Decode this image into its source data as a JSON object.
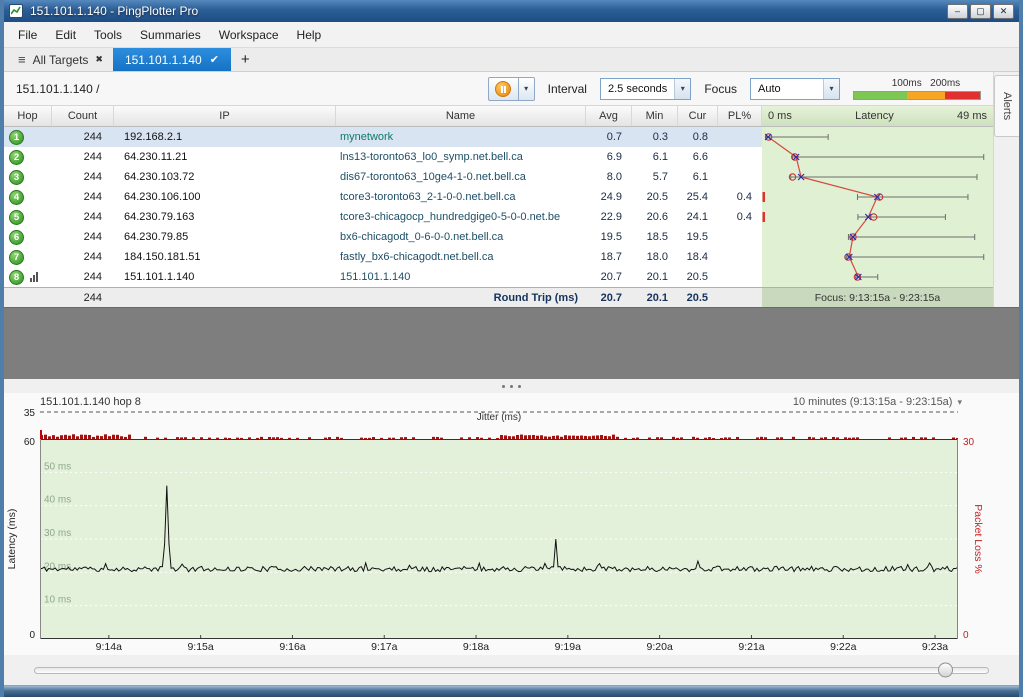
{
  "window": {
    "title": "151.101.1.140 - PingPlotter Pro",
    "minimize_glyph": "–",
    "maximize_glyph": "▢",
    "close_glyph": "✕"
  },
  "glyphs": {
    "caret": "▾",
    "hamburger": "≡"
  },
  "menu": {
    "items": [
      "File",
      "Edit",
      "Tools",
      "Summaries",
      "Workspace",
      "Help"
    ]
  },
  "tabs": {
    "all_targets_label": "All Targets",
    "all_targets_close": "✖",
    "active_label": "151.101.1.140",
    "active_check": "✔",
    "new_tab": "+"
  },
  "toolbar": {
    "target_label": "151.101.1.140 /",
    "interval_label": "Interval",
    "interval_value": "2.5 seconds",
    "focus_label": "Focus",
    "focus_value": "Auto",
    "legend": {
      "label_100": "100ms",
      "label_200": "200ms",
      "color_ok": "#7dc855",
      "color_warn": "#f5a623",
      "color_bad": "#e03030"
    }
  },
  "alerts_tab_label": "Alerts",
  "table": {
    "name_color": "#1d4f66",
    "headers": {
      "hop": "Hop",
      "count": "Count",
      "ip": "IP",
      "name": "Name",
      "avg": "Avg",
      "min": "Min",
      "cur": "Cur",
      "pl": "PL%",
      "graph_left": "0 ms",
      "graph_title": "Latency",
      "graph_right": "49 ms"
    },
    "rows": [
      {
        "hop": 1,
        "count": "244",
        "ip": "192.168.2.1",
        "name": "mynetwork",
        "name_color": "#0d7a66",
        "avg": "0.7",
        "min": "0.3",
        "cur": "0.8",
        "pl": ""
      },
      {
        "hop": 2,
        "count": "244",
        "ip": "64.230.11.21",
        "name": "lns13-toronto63_lo0_symp.net.bell.ca",
        "avg": "6.9",
        "min": "6.1",
        "cur": "6.6",
        "pl": ""
      },
      {
        "hop": 3,
        "count": "244",
        "ip": "64.230.103.72",
        "name": "dis67-toronto63_10ge4-1-0.net.bell.ca",
        "avg": "8.0",
        "min": "5.7",
        "cur": "6.1",
        "pl": ""
      },
      {
        "hop": 4,
        "count": "244",
        "ip": "64.230.106.100",
        "name": "tcore3-toronto63_2-1-0-0.net.bell.ca",
        "avg": "24.9",
        "min": "20.5",
        "cur": "25.4",
        "pl": "0.4"
      },
      {
        "hop": 5,
        "count": "244",
        "ip": "64.230.79.163",
        "name": "tcore3-chicagocp_hundredgige0-5-0-0.net.be",
        "avg": "22.9",
        "min": "20.6",
        "cur": "24.1",
        "pl": "0.4"
      },
      {
        "hop": 6,
        "count": "244",
        "ip": "64.230.79.85",
        "name": "bx6-chicagodt_0-6-0-0.net.bell.ca",
        "avg": "19.5",
        "min": "18.5",
        "cur": "19.5",
        "pl": ""
      },
      {
        "hop": 7,
        "count": "244",
        "ip": "184.150.181.51",
        "name": "fastly_bx6-chicagodt.net.bell.ca",
        "avg": "18.7",
        "min": "18.0",
        "cur": "18.4",
        "pl": ""
      },
      {
        "hop": 8,
        "count": "244",
        "ip": "151.101.1.140",
        "name": "151.101.1.140",
        "avg": "20.7",
        "min": "20.1",
        "cur": "20.5",
        "pl": "",
        "has_chart_icon": true
      }
    ],
    "summary": {
      "count": "244",
      "label": "Round Trip (ms)",
      "avg": "20.7",
      "min": "20.1",
      "cur": "20.5",
      "focus": "Focus: 9:13:15a - 9:23:15a"
    }
  },
  "timeline": {
    "header_left": "151.101.1.140 hop 8",
    "header_right": "10 minutes (9:13:15a - 9:23:15a)",
    "jitter_label": "Jitter (ms)",
    "jitter_axis_max": "35",
    "left_axis_max": "60",
    "left_axis_min": "0",
    "left_axis_label": "Latency (ms)",
    "right_axis_max": "30",
    "right_axis_min": "0",
    "right_axis_label": "Packet Loss %"
  },
  "chart_data": [
    {
      "type": "scatter",
      "title": "Trace graph: per-hop latency (avg = X marker, current = circle, min-max whisker), ms",
      "xlabel": "Latency",
      "xlim": [
        0,
        49
      ],
      "axis_labels": {
        "left": "0 ms",
        "center": "Latency",
        "right": "49 ms"
      },
      "hops": [
        {
          "hop": 1,
          "avg": 0.7,
          "cur": 0.8,
          "range": [
            0.3,
            14
          ],
          "loss": false
        },
        {
          "hop": 2,
          "avg": 6.9,
          "cur": 6.6,
          "range": [
            6.1,
            48.5
          ],
          "loss": false
        },
        {
          "hop": 3,
          "avg": 8.0,
          "cur": 6.1,
          "range": [
            5.7,
            47
          ],
          "loss": false
        },
        {
          "hop": 4,
          "avg": 24.9,
          "cur": 25.4,
          "range": [
            20.5,
            45
          ],
          "loss": true
        },
        {
          "hop": 5,
          "avg": 22.9,
          "cur": 24.1,
          "range": [
            20.6,
            40
          ],
          "loss": true
        },
        {
          "hop": 6,
          "avg": 19.5,
          "cur": 19.5,
          "range": [
            18.5,
            46.5
          ],
          "loss": false
        },
        {
          "hop": 7,
          "avg": 18.7,
          "cur": 18.4,
          "range": [
            18.0,
            48.5
          ],
          "loss": false
        },
        {
          "hop": 8,
          "avg": 20.7,
          "cur": 20.5,
          "range": [
            20.1,
            25
          ],
          "loss": false
        }
      ]
    },
    {
      "type": "line",
      "title": "151.101.1.140 hop 8 latency over time",
      "ylabel": "Latency (ms)",
      "ylim": [
        0,
        60
      ],
      "y2label": "Packet Loss %",
      "y2lim": [
        0,
        30
      ],
      "x_range_labels": [
        "9:13:15a",
        "9:23:15a"
      ],
      "duration_label": "10 minutes",
      "baseline_ms": 21,
      "noise_ms": 1.6,
      "spikes": [
        {
          "t": 0.138,
          "ms": 46
        },
        {
          "t": 0.562,
          "ms": 30
        }
      ],
      "gridlines": [
        {
          "ms": 50,
          "label": "50 ms"
        },
        {
          "ms": 40,
          "label": "40 ms"
        },
        {
          "ms": 30,
          "label": "30 ms"
        },
        {
          "ms": 20,
          "label": "20 ms"
        },
        {
          "ms": 10,
          "label": "10 ms"
        }
      ],
      "x_ticks": [
        {
          "t": 0.075,
          "label": "9:14a"
        },
        {
          "t": 0.175,
          "label": "9:15a"
        },
        {
          "t": 0.275,
          "label": "9:16a"
        },
        {
          "t": 0.375,
          "label": "9:17a"
        },
        {
          "t": 0.475,
          "label": "9:18a"
        },
        {
          "t": 0.575,
          "label": "9:19a"
        },
        {
          "t": 0.675,
          "label": "9:20a"
        },
        {
          "t": 0.775,
          "label": "9:21a"
        },
        {
          "t": 0.875,
          "label": "9:22a"
        },
        {
          "t": 0.975,
          "label": "9:23a"
        }
      ],
      "jitter": {
        "max": 35,
        "clusters": [
          [
            0.0,
            0.1
          ],
          [
            0.5,
            0.63
          ]
        ]
      }
    }
  ]
}
